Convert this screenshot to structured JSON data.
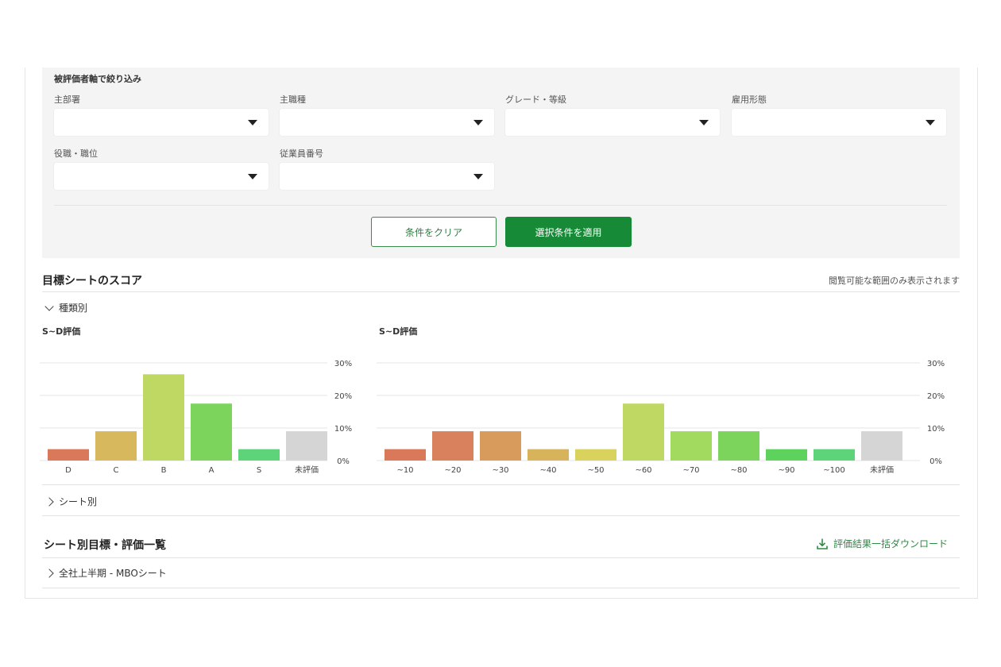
{
  "filter": {
    "title": "被評価者軸で絞り込み",
    "fields": {
      "dept": "主部署",
      "job": "主職種",
      "grade": "グレード・等級",
      "employment": "雇用形態",
      "position": "役職・職位",
      "employee_no": "従業員番号"
    },
    "clear_label": "条件をクリア",
    "apply_label": "選択条件を適用"
  },
  "score_section": {
    "title": "目標シートのスコア",
    "note": "閲覧可能な範囲のみ表示されます",
    "by_type_label": "種類別",
    "by_sheet_label": "シート別"
  },
  "list_section": {
    "title": "シート別目標・評価一覧",
    "download_label": "評価結果一括ダウンロード",
    "item_label": "全社上半期 - MBOシート"
  },
  "icons": {
    "caret": "caret-down-icon",
    "chevron_down": "chevron-down-icon",
    "chevron_right": "chevron-right-icon",
    "download": "download-icon"
  },
  "colors": {
    "accent": "#168a36",
    "panel_bg": "#f4f4f4"
  },
  "chart_data": [
    {
      "type": "bar",
      "title": "S~D評価",
      "categories": [
        "D",
        "C",
        "B",
        "A",
        "S",
        "未評価"
      ],
      "values": [
        3.5,
        9,
        26.5,
        17.5,
        3.5,
        9
      ],
      "colors": [
        "#d9795a",
        "#d8b85c",
        "#bfd864",
        "#7cd45d",
        "#5dd37a",
        "#d5d5d5"
      ],
      "ylim": [
        0,
        30
      ],
      "yticks": [
        "0%",
        "10%",
        "20%",
        "30%"
      ],
      "grid": true
    },
    {
      "type": "bar",
      "title": "S~D評価",
      "categories": [
        "~10",
        "~20",
        "~30",
        "~40",
        "~50",
        "~60",
        "~70",
        "~80",
        "~90",
        "~100",
        "未評価"
      ],
      "values": [
        3.5,
        9,
        9,
        3.5,
        3.5,
        17.5,
        9,
        9,
        3.5,
        3.5,
        9
      ],
      "colors": [
        "#d9795a",
        "#d9815d",
        "#d99b5c",
        "#d7b35c",
        "#d9d35e",
        "#bfd864",
        "#a2d95f",
        "#7cd45d",
        "#5dd35e",
        "#5dd37a",
        "#d5d5d5"
      ],
      "ylim": [
        0,
        30
      ],
      "yticks": [
        "0%",
        "10%",
        "20%",
        "30%"
      ],
      "grid": true
    }
  ]
}
